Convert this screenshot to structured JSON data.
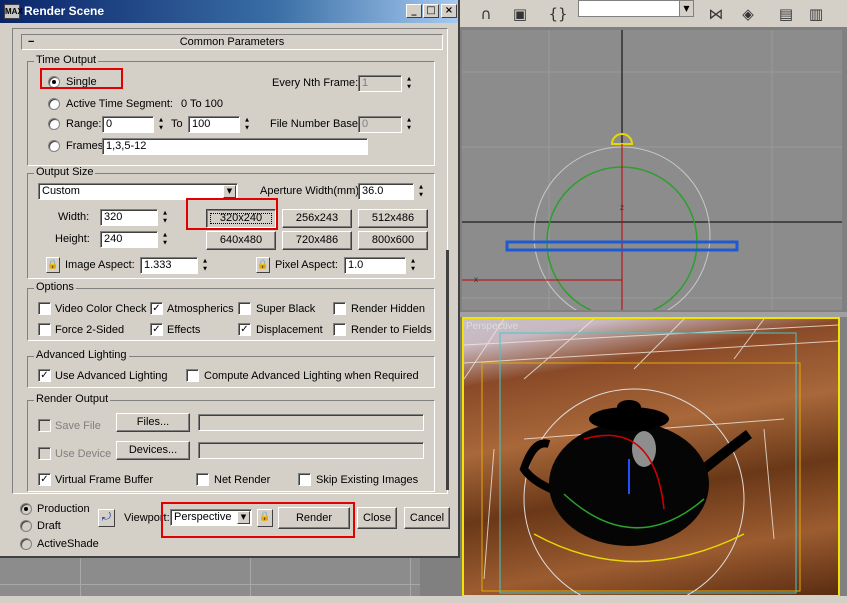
{
  "dialog": {
    "title": "Render Scene",
    "icon_text": "MAX",
    "minimize_glyph": "_",
    "maximize_glyph": "□",
    "close_glyph": "×",
    "rollout_title": "Common Parameters",
    "rollout_toggle": "−"
  },
  "time_output": {
    "legend": "Time Output",
    "single_label": "Single",
    "active_segment_label": "Active Time Segment:",
    "active_segment_value": "0 To 100",
    "range_label": "Range:",
    "range_from": "0",
    "range_to_label": "To",
    "range_to": "100",
    "frames_label": "Frames",
    "frames_value": "1,3,5-12",
    "every_nth_label": "Every Nth Frame:",
    "every_nth_value": "1",
    "file_number_base_label": "File Number Base:",
    "file_number_base_value": "0"
  },
  "output_size": {
    "legend": "Output Size",
    "preset": "Custom",
    "aperture_label": "Aperture Width(mm):",
    "aperture_value": "36.0",
    "width_label": "Width:",
    "width_value": "320",
    "height_label": "Height:",
    "height_value": "240",
    "presets": [
      "320x240",
      "256x243",
      "512x486",
      "640x480",
      "720x486",
      "800x600"
    ],
    "image_aspect_label": "Image Aspect:",
    "image_aspect_value": "1.333",
    "pixel_aspect_label": "Pixel Aspect:",
    "pixel_aspect_value": "1.0"
  },
  "options": {
    "legend": "Options",
    "video_color_check": "Video Color Check",
    "atmospherics": "Atmospherics",
    "super_black": "Super Black",
    "render_hidden": "Render Hidden",
    "force_2_sided": "Force 2-Sided",
    "effects": "Effects",
    "displacement": "Displacement",
    "render_to_fields": "Render to Fields"
  },
  "advanced_lighting": {
    "legend": "Advanced Lighting",
    "use_advanced": "Use Advanced Lighting",
    "compute_when_required": "Compute Advanced Lighting when Required"
  },
  "render_output": {
    "legend": "Render Output",
    "save_file": "Save File",
    "files_button": "Files...",
    "use_device": "Use Device",
    "devices_button": "Devices...",
    "virtual_frame_buffer": "Virtual Frame Buffer",
    "net_render": "Net Render",
    "skip_existing": "Skip Existing Images"
  },
  "bottom": {
    "production": "Production",
    "draft": "Draft",
    "activeshade": "ActiveShade",
    "viewport_label": "Viewport:",
    "viewport_value": "Perspective",
    "render_button": "Render",
    "close_button": "Close",
    "cancel_button": "Cancel"
  },
  "checkmark": "✓",
  "lock_glyph": "🔒",
  "viewport_labels": {
    "axis_z": "z",
    "axis_x": "x",
    "persp_label": "Perspective"
  }
}
